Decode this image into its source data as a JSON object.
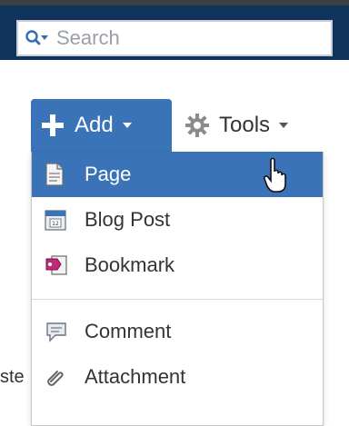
{
  "search": {
    "placeholder": "Search"
  },
  "toolbar": {
    "add_label": "Add",
    "tools_label": "Tools"
  },
  "menu": {
    "group1": [
      {
        "label": "Page",
        "icon": "page-icon",
        "active": true
      },
      {
        "label": "Blog Post",
        "icon": "blog-post-icon",
        "active": false
      },
      {
        "label": "Bookmark",
        "icon": "bookmark-icon",
        "active": false
      }
    ],
    "group2": [
      {
        "label": "Comment",
        "icon": "comment-icon",
        "active": false
      },
      {
        "label": "Attachment",
        "icon": "attachment-icon",
        "active": false
      }
    ]
  },
  "background_text": "ste",
  "colors": {
    "header": "#10335b",
    "accent": "#3b73b9"
  }
}
